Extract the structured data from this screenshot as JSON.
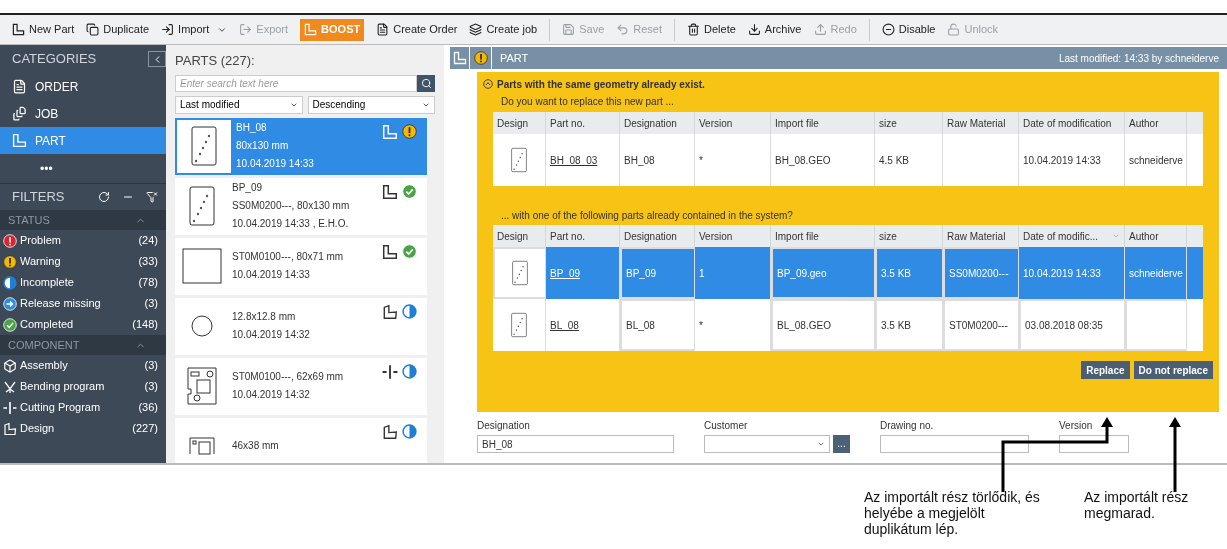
{
  "toolbar": [
    {
      "label": "New Part",
      "kind": "button",
      "disabled": false,
      "separator": false
    },
    {
      "label": "Duplicate",
      "kind": "button",
      "disabled": false,
      "separator": false
    },
    {
      "label": "Import",
      "kind": "dropdown",
      "disabled": false,
      "separator": false
    },
    {
      "label": "Export",
      "kind": "button",
      "disabled": true,
      "separator": false
    },
    {
      "label": "BOOST",
      "kind": "boost",
      "disabled": false,
      "separator": false
    },
    {
      "label": "Create Order",
      "kind": "button",
      "disabled": false,
      "separator": false
    },
    {
      "label": "Create job",
      "kind": "button",
      "disabled": false,
      "separator": false
    },
    {
      "label": "Save",
      "kind": "button",
      "disabled": true,
      "separator": true
    },
    {
      "label": "Reset",
      "kind": "button",
      "disabled": true,
      "separator": false
    },
    {
      "label": "Delete",
      "kind": "button",
      "disabled": false,
      "separator": true
    },
    {
      "label": "Archive",
      "kind": "button",
      "disabled": false,
      "separator": false
    },
    {
      "label": "Redo",
      "kind": "button",
      "disabled": true,
      "separator": false
    },
    {
      "label": "Disable",
      "kind": "button",
      "disabled": false,
      "separator": true
    },
    {
      "label": "Unlock",
      "kind": "button",
      "disabled": true,
      "separator": false
    }
  ],
  "sidebar": {
    "title": "CATEGORIES",
    "items": [
      {
        "label": "ORDER",
        "selected": false
      },
      {
        "label": "JOB",
        "selected": false
      },
      {
        "label": "PART",
        "selected": true
      }
    ],
    "more": "•••",
    "filters_title": "FILTERS",
    "sections": [
      {
        "title": "STATUS",
        "items": [
          {
            "label": "Problem",
            "count": "(24)",
            "kind": "problem"
          },
          {
            "label": "Warning",
            "count": "(33)",
            "kind": "warning"
          },
          {
            "label": "Incomplete",
            "count": "(78)",
            "kind": "incomplete"
          },
          {
            "label": "Release missing",
            "count": "(3)",
            "kind": "release"
          },
          {
            "label": "Completed",
            "count": "(148)",
            "kind": "completed"
          }
        ]
      },
      {
        "title": "COMPONENT",
        "items": [
          {
            "label": "Assembly",
            "count": "(3)",
            "kind": "assembly"
          },
          {
            "label": "Bending program",
            "count": "(3)",
            "kind": "bending"
          },
          {
            "label": "Cutting Program",
            "count": "(36)",
            "kind": "cutting"
          },
          {
            "label": "Design",
            "count": "(227)",
            "kind": "design"
          }
        ]
      }
    ]
  },
  "parts": {
    "title": "PARTS (227):",
    "search_placeholder": "Enter search text here",
    "sort": "Last modified",
    "order": "Descending",
    "items": [
      {
        "lines": [
          "BH_08",
          "80x130 mm",
          "10.04.2019 14:33"
        ],
        "thumbnail": {
          "kind": "plate"
        },
        "type_icon": {
          "kind": "part"
        },
        "status_icon": {
          "kind": "warning"
        },
        "selected": true
      },
      {
        "lines": [
          "BP_09",
          "SS0M0200---, 80x130 mm",
          "10.04.2019 14:33 , E.H.O."
        ],
        "thumbnail": {
          "kind": "plate"
        },
        "type_icon": {
          "kind": "part"
        },
        "status_icon": {
          "kind": "completed"
        },
        "selected": false
      },
      {
        "lines": [
          "ST0M0100---, 80x71 mm",
          "10.04.2019 14:33"
        ],
        "thumbnail": {
          "kind": "rect"
        },
        "type_icon": {
          "kind": "part"
        },
        "status_icon": {
          "kind": "completed"
        },
        "selected": false
      },
      {
        "lines": [
          "12.8x12.8 mm",
          "10.04.2019 14:32"
        ],
        "thumbnail": {
          "kind": "circle"
        },
        "type_icon": {
          "kind": "design"
        },
        "status_icon": {
          "kind": "incomplete"
        },
        "selected": false
      },
      {
        "lines": [
          "ST0M0100---, 62x69 mm",
          "10.04.2019 14:32"
        ],
        "thumbnail": {
          "kind": "complex"
        },
        "type_icon": {
          "kind": "cutting"
        },
        "status_icon": {
          "kind": "incomplete"
        },
        "selected": false
      },
      {
        "lines": [
          "46x38 mm"
        ],
        "thumbnail": {
          "kind": "small"
        },
        "type_icon": {
          "kind": "design"
        },
        "status_icon": {
          "kind": "incomplete"
        },
        "selected": false
      }
    ]
  },
  "panel": {
    "title": "PART",
    "last_modified": "Last modified: 14:33 by schneiderve",
    "warning": {
      "title": "Parts with the same geometry already exist.",
      "question": "Do you want to replace this new part ...",
      "columns": [
        "Design",
        "Part no.",
        "Designation",
        "Version",
        "Import file",
        "size",
        "Raw Material",
        "Date of modification",
        "Author"
      ],
      "rows": [
        {
          "cells": [
            "",
            "BH_08_03",
            "BH_08",
            "*",
            "BH_08.GEO",
            "4.5 KB",
            "",
            "10.04.2019 14:33",
            "schneiderve"
          ],
          "selected": false
        }
      ],
      "question2": "... with one of the following parts already contained in the system?",
      "columns2": [
        "Design",
        "Part no.",
        "Designation",
        "Version",
        "Import file",
        "size",
        "Raw Material",
        "Date of modific...",
        "Author"
      ],
      "rows2": [
        {
          "cells": [
            "",
            "BP_09",
            "BP_09",
            "1",
            "BP_09.geo",
            "3.5 KB",
            "SS0M0200---",
            "10.04.2019 14:33",
            "schneiderve"
          ],
          "selected": true
        },
        {
          "cells": [
            "",
            "BL_08",
            "BL_08",
            "*",
            "BL_08.GEO",
            "3.5 KB",
            "ST0M0200---",
            "03.08.2018 08:35",
            ""
          ],
          "selected": false
        }
      ],
      "buttons": [
        "Replace",
        "Do not replace"
      ]
    },
    "fields": [
      {
        "label": "Designation",
        "value": "BH_08",
        "kind": "text"
      },
      {
        "label": "Customer",
        "kind": "combo",
        "button": "..."
      },
      {
        "label": "Drawing no.",
        "kind": "text"
      },
      {
        "label": "Version",
        "kind": "text"
      }
    ]
  },
  "annotations": [
    "Az importált rész törlődik, és helyébe a megjelölt duplikátum lép.",
    "Az importált rész megmarad."
  ]
}
